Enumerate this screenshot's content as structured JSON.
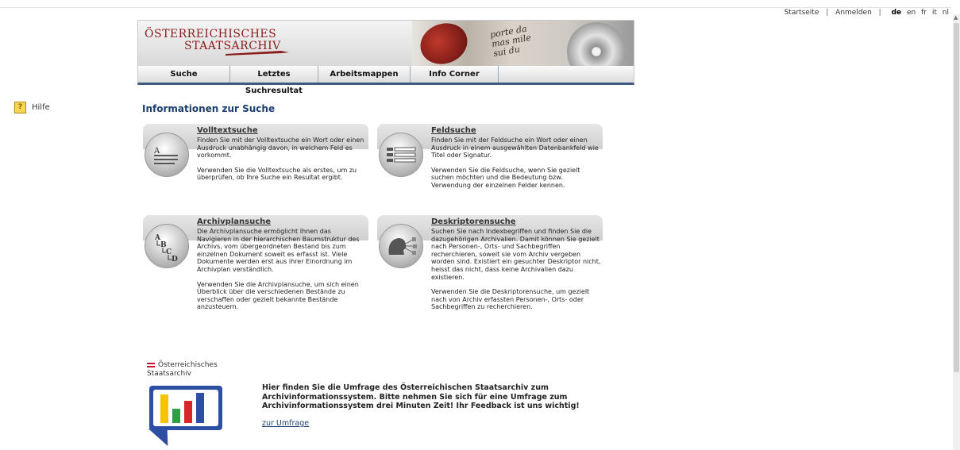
{
  "toplinks": {
    "startseite": "Startseite",
    "separator": "|",
    "anmelden": "Anmelden",
    "languages": [
      "de",
      "en",
      "fr",
      "it",
      "nl"
    ],
    "active_language": "de"
  },
  "banner": {
    "logo_line1": "ÖSTERREICHISCHES",
    "logo_line2": "STAATSARCHIV",
    "script_text": "porte da\nmas mile\nsui du"
  },
  "nav": {
    "tabs": [
      "Suche",
      "Letztes Suchresultat",
      "Arbeitsmappen",
      "Info Corner"
    ]
  },
  "sidebar": {
    "help_label": "Hilfe",
    "help_icon_glyph": "?"
  },
  "page": {
    "heading": "Informationen zur Suche"
  },
  "cards": [
    {
      "title": "Volltextsuche",
      "icon": "document-lines-icon",
      "p1": "Finden Sie mit der Volltextsuche ein Wort oder einen Ausdruck unabhängig davon, in welchem Feld es vorkommt.",
      "p2": "Verwenden Sie die Volltextsuche als erstes, um zu überprüfen, ob Ihre Suche ein Resultat ergibt."
    },
    {
      "title": "Feldsuche",
      "icon": "form-fields-icon",
      "p1": "Finden Sie mit der Feldsuche ein Wort oder einen Ausdruck in einem ausgewählten Datenbankfeld wie Titel oder Signatur.",
      "p2": "Verwenden Sie die Feldsuche, wenn Sie gezielt suchen möchten und die Bedeutung bzw. Verwendung der einzelnen Felder kennen."
    },
    {
      "title": "Archivplansuche",
      "icon": "tree-abcd-icon",
      "p1": "Die Archivplansuche ermöglicht Ihnen das Navigieren in der hierarchischen Baumstruktur des Archivs, vom übergeordneten Bestand bis zum einzelnen Dokument soweit es erfasst ist. Viele Dokumente werden erst aus ihrer Einordnung im Archivplan verständlich.",
      "p2": "Verwenden Sie die Archivplansuche, um sich einen Überblick über die verschiedenen Bestände zu verschaffen oder gezielt bekannte Bestände anzusteuern."
    },
    {
      "title": "Deskriptorensuche",
      "icon": "head-network-icon",
      "p1": "Suchen Sie nach Indexbegriffen und finden Sie die dazugehörigen Archivalien. Damit können Sie gezielt nach Personen-, Orts- und Sachbegriffen recherchieren, soweit sie vom Archiv vergeben worden sind. Existiert ein gesuchter Deskriptor nicht, heisst das nicht, dass keine Archivalien dazu existieren.",
      "p2": "Verwenden Sie die Deskriptorensuche, um gezielt nach von Archiv erfassten Personen-, Orts- oder Sachbegriffen zu recherchieren."
    }
  ],
  "survey": {
    "logo_line1": "Österreichisches",
    "logo_line2": "Staatsarchiv",
    "text": "Hier finden Sie die Umfrage des Österreichischen Staatsarchiv zum Archivinformationssystem. Bitte nehmen Sie sich für eine Umfrage zum Archivinformationssystem drei Minuten Zeit! Ihr Feedback ist uns wichtig!",
    "link": "zur Umfrage",
    "bar_colors": [
      "#f5c400",
      "#2f9e44",
      "#d62828",
      "#2d4fa3"
    ]
  }
}
